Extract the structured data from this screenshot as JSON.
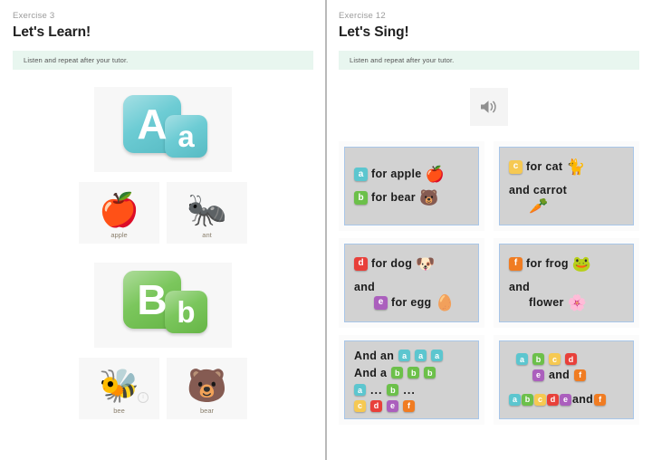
{
  "colors": {
    "a": "#5cc6cf",
    "b": "#6cc04a",
    "c": "#f6c952",
    "d": "#e8403a",
    "e": "#ab5fbd",
    "f": "#f07c22",
    "banner_bg": "#e8f6ef",
    "card_border": "#a8c6e8",
    "card_bg": "#d2d2d2",
    "divider": "#b9b9b9"
  },
  "left": {
    "exercise_label": "Exercise 3",
    "title": "Let's Learn!",
    "instruction": "Listen and repeat after your tutor.",
    "letters": [
      {
        "upper": "A",
        "lower": "a",
        "color_key": "a"
      },
      {
        "upper": "B",
        "lower": "b",
        "color_key": "b"
      }
    ],
    "words_a": [
      {
        "label": "apple",
        "icon": "apple-emoji",
        "glyph": "🍎"
      },
      {
        "label": "ant",
        "icon": "ant-emoji",
        "glyph": "🐜"
      }
    ],
    "words_b": [
      {
        "label": "bee",
        "icon": "bee-emoji",
        "glyph": "🐝",
        "hint": "i"
      },
      {
        "label": "bear",
        "icon": "bear-emoji",
        "glyph": "🐻"
      }
    ]
  },
  "right": {
    "exercise_label": "Exercise 12",
    "title": "Let's Sing!",
    "instruction": "Listen and repeat after your tutor.",
    "audio_button": "speaker-icon",
    "cards": [
      {
        "id": "card-a-b",
        "lines": [
          {
            "tile": "a",
            "text": "for apple",
            "emoji": "🍎"
          },
          {
            "tile": "b",
            "text": "for bear",
            "emoji": "🐻"
          }
        ]
      },
      {
        "id": "card-c",
        "lines": [
          {
            "tile": "c",
            "text": "for cat",
            "emoji": "🐈"
          },
          {
            "tile": "",
            "text": "and carrot",
            "emoji": "🥕"
          }
        ]
      },
      {
        "id": "card-d-e",
        "lines": [
          {
            "tile": "d",
            "text": "for dog",
            "emoji": "🐶"
          },
          {
            "tile": "",
            "text": "and",
            "emoji": ""
          },
          {
            "tile": "e",
            "text": "for egg",
            "emoji": "🥚"
          }
        ]
      },
      {
        "id": "card-f",
        "lines": [
          {
            "tile": "f",
            "text": "for frog",
            "emoji": "🐸"
          },
          {
            "tile": "",
            "text": "and",
            "emoji": ""
          },
          {
            "tile": "",
            "text": "flower",
            "emoji": "🌸"
          }
        ]
      },
      {
        "id": "card-chorus-1",
        "rows": [
          {
            "text": "And an",
            "tiles": [
              "a",
              "a",
              "a"
            ]
          },
          {
            "text": "And a",
            "tiles": [
              "b",
              "b",
              "b"
            ]
          },
          {
            "text": "",
            "tiles": [
              "a"
            ],
            "dots": "...",
            "tiles2": [
              "b"
            ],
            "dots2": "..."
          },
          {
            "text": "",
            "tiles": [
              "c",
              "d",
              "e",
              "f"
            ]
          }
        ]
      },
      {
        "id": "card-chorus-2",
        "rows": [
          {
            "text": "",
            "tiles": [
              "a",
              "b",
              "c",
              "d"
            ]
          },
          {
            "text": "and",
            "tiles_before": [
              "e"
            ],
            "tiles_after": [
              "f"
            ]
          },
          {
            "text": "and",
            "tiles_before": [
              "a",
              "b",
              "c",
              "d",
              "e"
            ],
            "tiles_after": [
              "f"
            ]
          }
        ]
      }
    ]
  }
}
